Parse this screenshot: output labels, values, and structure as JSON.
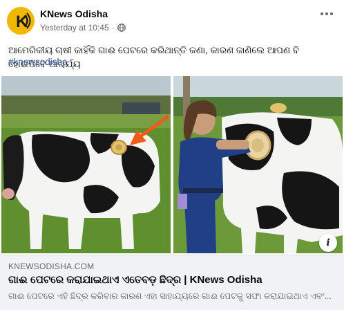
{
  "post": {
    "page_name": "KNews Odisha",
    "timestamp": "Yesterday at 10:45",
    "separator": "·",
    "caption": "ଆମେରିକୀୟ ଚାଷୀ କାହିଁକି ଗାଈ ପେଟରେ କରିଥାନ୍ତି କଣା, କାରଣ ଜାଣିଲେ ଆପଣ ବି ହୋଇପିବେ ଆଶ୍ଚର୍ଯ୍ୟ",
    "hashtag": "#knewsodisha",
    "avatar_letter": "K"
  },
  "icons": {
    "avatar": "knews-logo-icon",
    "audience": "globe-icon",
    "more": "more-options-icon",
    "info": "info-icon",
    "arrow": "arrow-icon"
  },
  "link_preview": {
    "domain": "KNEWSODISHA.COM",
    "title": "ଗାଈ ପେଟରେ କରାଯାଇଥାଏ ଏତେବଡ଼ ଛିଦ୍ର | KNews Odisha",
    "description": "ଗାଈ ପେଟରେ ଏହି ଛିଦ୍ର କରିବାର କାରଣ ଏହା ସାହାଯ୍ୟରେ ଗାଈ ପେଟକୁ ସଫା କରାଯାଇଥାଏ ଏବଂ...",
    "info_label": "i"
  },
  "colors": {
    "link_blue": "#385898",
    "secondary_text": "#65676b",
    "brand_yellow": "#f2b800",
    "arrow_orange": "#f05a1a"
  }
}
